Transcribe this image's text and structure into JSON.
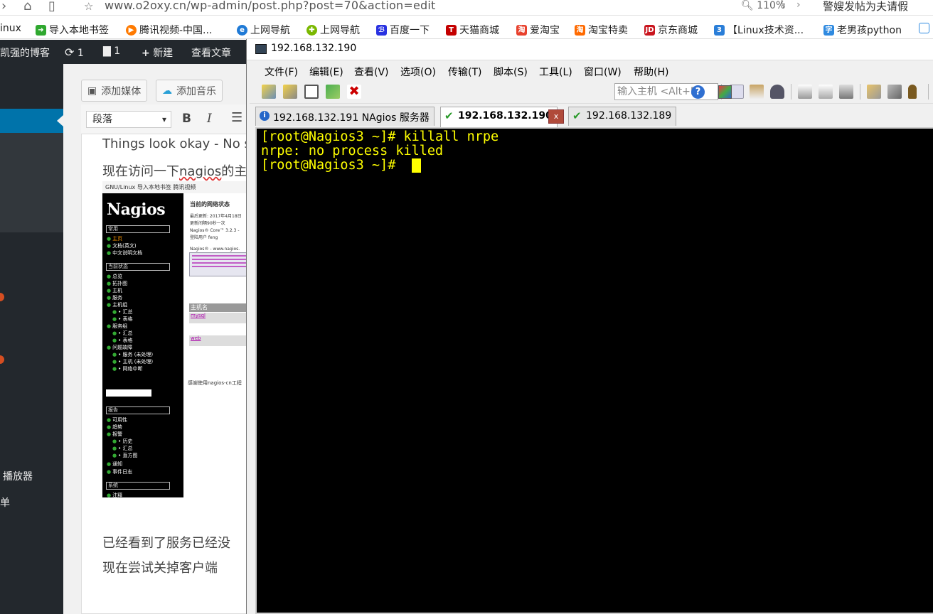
{
  "browser": {
    "url": "www.o2oxy.cn/wp-admin/post.php?post=70&action=edit",
    "zoom": "110%",
    "page_info": "警嫂发帖为夫请假",
    "bookmarks": [
      {
        "label": "inux",
        "icon": "",
        "color": ""
      },
      {
        "label": "导入本地书签",
        "icon": "arrow-import-icon",
        "color": "#2fa82f"
      },
      {
        "label": "腾讯视频-中国...",
        "icon": "tencent-video-icon",
        "color": "#ff7a00"
      },
      {
        "label": "上网导航",
        "icon": "ie-icon",
        "color": "#1f7ad6"
      },
      {
        "label": "上网导航",
        "icon": "compass-icon",
        "color": "#7ab800"
      },
      {
        "label": "百度一下",
        "icon": "baidu-paw-icon",
        "color": "#2932e1"
      },
      {
        "label": "天猫商城",
        "icon": "tmall-icon",
        "color": "#c40000"
      },
      {
        "label": "爱淘宝",
        "icon": "aitaobao-icon",
        "color": "#e8412d"
      },
      {
        "label": "淘宝特卖",
        "icon": "taobao-icon",
        "color": "#ff6a00"
      },
      {
        "label": "京东商城",
        "icon": "jd-icon",
        "color": "#c9151e"
      },
      {
        "label": "【Linux技术资...",
        "icon": "blog-icon",
        "color": "#2a7ed8"
      },
      {
        "label": "老男孩python",
        "icon": "bookmark-icon",
        "color": "#2f8ae0"
      }
    ]
  },
  "wp": {
    "site_name": "凯强的博客",
    "updates_count": "1",
    "comments_count": "1",
    "new_label": "新建",
    "view_post_label": "查看文章",
    "sidebar_player_label": "播放器",
    "sidebar_single_label": "单",
    "add_media_label": "添加媒体",
    "add_music_label": "添加音乐",
    "format_select": "段落",
    "bold": "B",
    "italic": "I",
    "editor_line1": "Things look okay - No se",
    "editor_line2_prefix": "现在访问一下",
    "editor_line2_word": "nagios",
    "editor_line2_suffix": "的主",
    "editor_line3": "已经看到了服务已经没",
    "editor_line4": "现在尝试关掉客户端"
  },
  "nagios_thumb": {
    "top_bar": "GNU/Linux   导入本地书签   腾讯视频",
    "logo": "Nagios",
    "section_general": "常用",
    "general_items": [
      "主页",
      "文档(英文)",
      "中文说明文档"
    ],
    "section_status": "当前状态",
    "status_items": [
      "总览",
      "拓扑图",
      "主机",
      "服务",
      "主机组",
      "• 汇总",
      "• 表格",
      "服务组",
      "• 汇总",
      "• 表格",
      "问题故障",
      "• 服务 (未处理)",
      "• 主机 (未处理)",
      "• 网络中断"
    ],
    "section_reports": "报告",
    "report_items": [
      "可用性",
      "趋势",
      "报警",
      "• 历史",
      "• 汇总",
      "• 直方图",
      "通知",
      "事件日志"
    ],
    "section_system": "系统",
    "system_items": [
      "注释"
    ],
    "right_title": "当前的网络状态",
    "right_lines": [
      "最后更新: 2017年4月18日",
      "更新间隔90秒一次",
      "Nagios® Core™ 3.2.3 -",
      "登陆用户 feng",
      "Nagios® - www.nagios."
    ],
    "host_header": "主机名",
    "host1": "mysql",
    "host2": "web",
    "footer": "感谢使用nagios-cn工程"
  },
  "crt": {
    "title": "192.168.132.190",
    "menu": [
      "文件(F)",
      "编辑(E)",
      "查看(V)",
      "选项(O)",
      "传输(T)",
      "脚本(S)",
      "工具(L)",
      "窗口(W)",
      "帮助(H)"
    ],
    "host_placeholder": "输入主机 <Alt+R>",
    "tabs": [
      {
        "label": "192.168.132.191 NAgios 服务器",
        "status": "info"
      },
      {
        "label": "192.168.132.190",
        "status": "connected"
      },
      {
        "label": "192.168.132.189",
        "status": "connected"
      }
    ],
    "close_glyph": "x",
    "terminal_lines": [
      "[root@Nagios3 ~]# killall nrpe",
      "nrpe: no process killed",
      "[root@Nagios3 ~]# "
    ],
    "colors": {
      "terminal_bg": "#000000",
      "terminal_fg": "#ffff00"
    }
  }
}
